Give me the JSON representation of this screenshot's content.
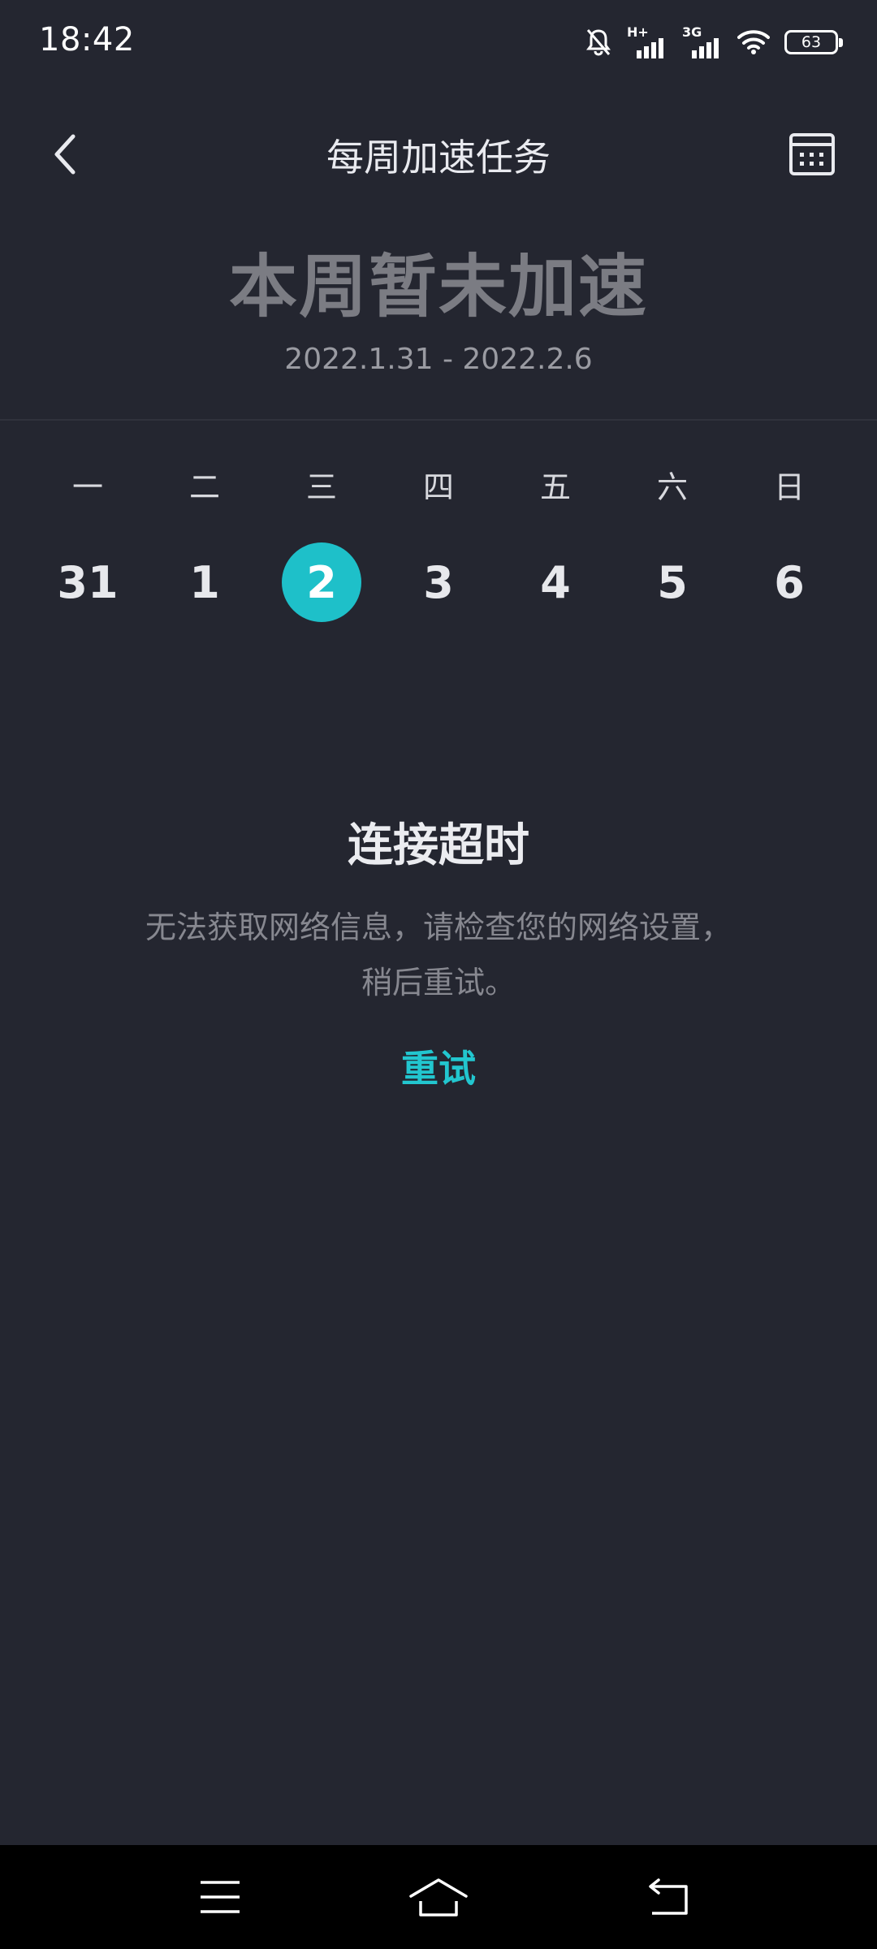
{
  "status_bar": {
    "time": "18:42",
    "icons": [
      "bell-off-icon",
      "signal-h-plus-icon",
      "signal-3g-icon",
      "wifi-icon",
      "battery-icon"
    ],
    "network_1": "H+",
    "network_2": "3G",
    "battery": "63"
  },
  "header": {
    "title": "每周加速任务",
    "back_icon": "chevron-left-icon",
    "calendar_icon": "calendar-icon"
  },
  "summary": {
    "status": "本周暂未加速",
    "date_range": "2022.1.31 - 2022.2.6"
  },
  "week": {
    "weekdays": [
      "一",
      "二",
      "三",
      "四",
      "五",
      "六",
      "日"
    ],
    "days": [
      "31",
      "1",
      "2",
      "3",
      "4",
      "5",
      "6"
    ],
    "selected_index": 2
  },
  "error": {
    "title": "连接超时",
    "message": "无法获取网络信息，请检查您的网络设置，稍后重试。",
    "retry_label": "重试"
  },
  "nav_bar": {
    "icons": [
      "menu-icon",
      "home-icon",
      "back-icon"
    ]
  },
  "colors": {
    "background": "#242630",
    "accent": "#1ec0c9",
    "nav_background": "#000000"
  }
}
